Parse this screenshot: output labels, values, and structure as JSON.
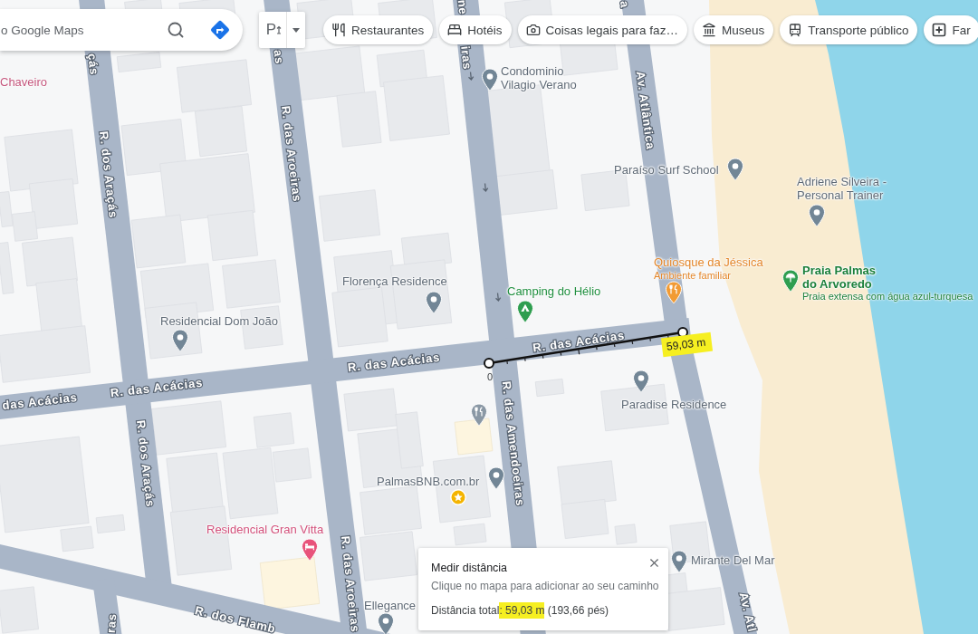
{
  "search": {
    "placeholder": "o Google Maps"
  },
  "layer_button": {
    "label": "P"
  },
  "chips": [
    {
      "label": "Restaurantes",
      "kind": "restaurants"
    },
    {
      "label": "Hotéis",
      "kind": "hotels"
    },
    {
      "label": "Coisas legais para faz…",
      "kind": "attractions"
    },
    {
      "label": "Museus",
      "kind": "museums"
    },
    {
      "label": "Transporte público",
      "kind": "transit"
    },
    {
      "label": "Far",
      "kind": "pharmacy"
    }
  ],
  "street_labels": [
    {
      "text": "çás"
    },
    {
      "text": "as"
    },
    {
      "text": "ne"
    },
    {
      "text": "iras"
    },
    {
      "text": "a"
    },
    {
      "text": "R. dos Araçás"
    },
    {
      "text": "R. das Aroeiras"
    },
    {
      "text": "Av. Atlântica"
    },
    {
      "text": "das Acácias"
    },
    {
      "text": "R. das Acácias"
    },
    {
      "text": "R. das Acácias"
    },
    {
      "text": "R. das Acácias"
    },
    {
      "text": "R. dos Araçás"
    },
    {
      "text": "R. das Amendoeiras"
    },
    {
      "text": "R. das Aroeiras"
    },
    {
      "text": "Av. Atl"
    },
    {
      "text": "R. dos Flamb"
    },
    {
      "text": "ras"
    }
  ],
  "places": [
    {
      "name": "Chaveiro",
      "kind": "shop"
    },
    {
      "name": "Condominio Vilagio Verano",
      "kind": "place"
    },
    {
      "name": "Paraíso Surf School",
      "kind": "place"
    },
    {
      "name": "Adriene Silveira - Personal Trainer",
      "kind": "place"
    },
    {
      "name": "Florença Residence",
      "kind": "place"
    },
    {
      "name": "Camping do Hélio",
      "kind": "camping"
    },
    {
      "name": "Quiosque da Jéssica",
      "description": "Ambiente familiar",
      "kind": "food"
    },
    {
      "name": "Praia Palmas do Arvoredo",
      "description": "Praia extensa com água azul-turquesa",
      "kind": "beach"
    },
    {
      "name": "Residencial Dom João",
      "kind": "place"
    },
    {
      "name": "Paradise Residence",
      "kind": "place"
    },
    {
      "kind": "restaurant"
    },
    {
      "name": "PalmasBNB.com.br",
      "kind": "place"
    },
    {
      "kind": "saved"
    },
    {
      "name": "Residencial Gran Vitta",
      "kind": "hotel"
    },
    {
      "name": "Mirante Del Mar",
      "kind": "place"
    },
    {
      "name": "Ellegance",
      "kind": "place"
    }
  ],
  "measure": {
    "start_label": "0",
    "distance": "59,03 m",
    "highlighted": true
  },
  "panel": {
    "title": "Medir distância",
    "hint": "Clique no mapa para adicionar ao seu caminho",
    "total": [
      {
        "text": "Distância total",
        "highlighted": false
      },
      {
        "text": ": 59,03 m",
        "highlighted": true
      },
      {
        "text": " (193,66 pés)",
        "highlighted": false
      }
    ]
  }
}
